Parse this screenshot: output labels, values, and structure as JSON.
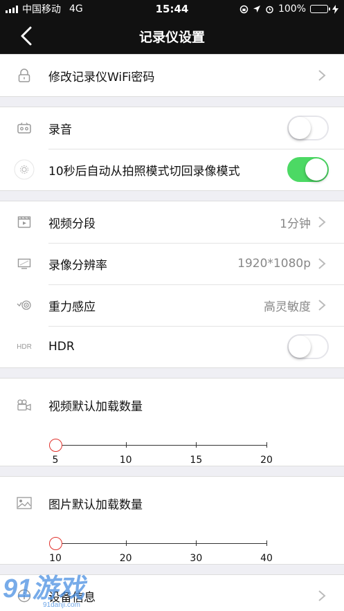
{
  "status": {
    "carrier": "中国移动",
    "network": "4G",
    "time": "15:44",
    "battery": "100%"
  },
  "nav": {
    "title": "记录仪设置"
  },
  "wifi": {
    "label": "修改记录仪WiFi密码"
  },
  "record_audio": {
    "label": "录音",
    "on": false
  },
  "auto_switch": {
    "label": "10秒后自动从拍照模式切回录像模式",
    "on": true
  },
  "video_segment": {
    "label": "视频分段",
    "value": "1分钟"
  },
  "resolution": {
    "label": "录像分辨率",
    "value": "1920*1080p"
  },
  "gsensor": {
    "label": "重力感应",
    "value": "高灵敏度"
  },
  "hdr": {
    "icon_text": "HDR",
    "label": "HDR",
    "on": false
  },
  "video_load": {
    "label": "视频默认加载数量",
    "ticks": [
      "5",
      "10",
      "15",
      "20"
    ],
    "selected": "5"
  },
  "image_load": {
    "label": "图片默认加载数量",
    "ticks": [
      "10",
      "20",
      "30",
      "40"
    ],
    "selected": "10"
  },
  "device_info": {
    "label": "设备信息"
  },
  "watermark": {
    "text": "91游戏",
    "url": "91danji.com"
  },
  "colors": {
    "accent_green": "#4cd964",
    "slider_thumb": "#e0312b",
    "bar": "#111111"
  }
}
